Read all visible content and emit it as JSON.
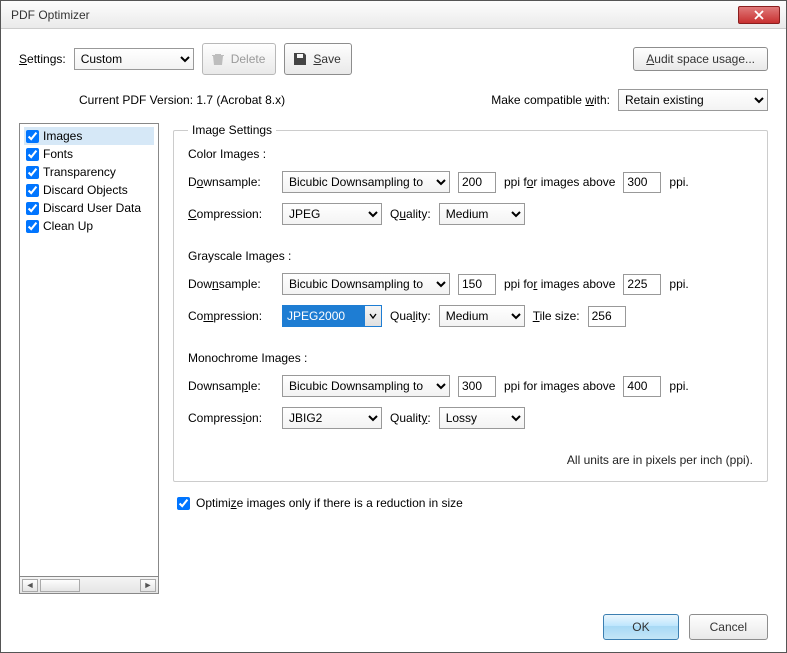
{
  "window": {
    "title": "PDF Optimizer"
  },
  "toolbar": {
    "settings_label": "Settings:",
    "settings_value": "Custom",
    "delete_label": "Delete",
    "save_label": "Save",
    "audit_label": "Audit space usage..."
  },
  "version": {
    "current_label": "Current PDF Version: 1.7 (Acrobat 8.x)",
    "compat_label": "Make compatible with:",
    "compat_value": "Retain existing"
  },
  "sidebar": {
    "items": [
      {
        "label": "Images",
        "checked": true,
        "selected": true
      },
      {
        "label": "Fonts",
        "checked": true,
        "selected": false
      },
      {
        "label": "Transparency",
        "checked": true,
        "selected": false
      },
      {
        "label": "Discard Objects",
        "checked": true,
        "selected": false
      },
      {
        "label": "Discard User Data",
        "checked": true,
        "selected": false
      },
      {
        "label": "Clean Up",
        "checked": true,
        "selected": false
      }
    ]
  },
  "panel": {
    "legend": "Image Settings",
    "downsample_label": "Downsample:",
    "compression_label": "Compression:",
    "quality_label": "Quality:",
    "tile_label": "Tile size:",
    "ppi_above_label": "ppi for images above",
    "ppi_label": "ppi.",
    "color": {
      "title": "Color Images :",
      "method": "Bicubic Downsampling to",
      "ppi": "200",
      "above": "300",
      "compression": "JPEG",
      "quality": "Medium"
    },
    "gray": {
      "title": "Grayscale Images :",
      "method": "Bicubic Downsampling to",
      "ppi": "150",
      "above": "225",
      "compression": "JPEG2000",
      "quality": "Medium",
      "tile": "256"
    },
    "mono": {
      "title": "Monochrome Images :",
      "method": "Bicubic Downsampling to",
      "ppi": "300",
      "above": "400",
      "compression": "JBIG2",
      "quality": "Lossy"
    },
    "units_note": "All units are in pixels per inch (ppi)."
  },
  "optimize": {
    "checked": true,
    "label": "Optimize images only if there is a reduction in size"
  },
  "buttons": {
    "ok": "OK",
    "cancel": "Cancel"
  }
}
